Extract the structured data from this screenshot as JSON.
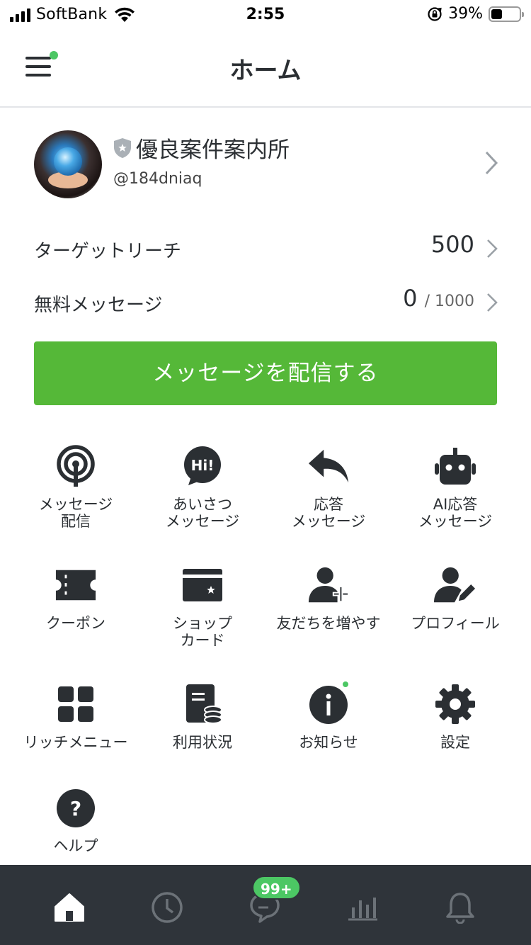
{
  "status_bar": {
    "carrier": "SoftBank",
    "time": "2:55",
    "battery_percent": "39%",
    "battery_level": 0.39
  },
  "header": {
    "title": "ホーム"
  },
  "account": {
    "name": "優良案件案内所",
    "id": "@184dniaq"
  },
  "stats": {
    "target_reach_label": "ターゲットリーチ",
    "target_reach_value": "500",
    "free_messages_label": "無料メッセージ",
    "free_messages_used": "0",
    "free_messages_limit": "/ 1000"
  },
  "broadcast_button": "メッセージを配信する",
  "menu": [
    {
      "label": "メッセージ\n配信",
      "icon": "broadcast-icon"
    },
    {
      "label": "あいさつ\nメッセージ",
      "icon": "hi-bubble-icon"
    },
    {
      "label": "応答\nメッセージ",
      "icon": "reply-icon"
    },
    {
      "label": "AI応答\nメッセージ",
      "icon": "robot-icon"
    },
    {
      "label": "クーポン",
      "icon": "coupon-icon"
    },
    {
      "label": "ショップ\nカード",
      "icon": "shop-card-icon"
    },
    {
      "label": "友だちを増やす",
      "icon": "add-friend-icon"
    },
    {
      "label": "プロフィール",
      "icon": "profile-edit-icon"
    },
    {
      "label": "リッチメニュー",
      "icon": "rich-menu-icon"
    },
    {
      "label": "利用状況",
      "icon": "usage-icon"
    },
    {
      "label": "お知らせ",
      "icon": "info-icon"
    },
    {
      "label": "設定",
      "icon": "gear-icon"
    },
    {
      "label": "ヘルプ",
      "icon": "help-icon"
    }
  ],
  "tabbar": {
    "chat_badge": "99+",
    "tabs": [
      "home-icon",
      "clock-icon",
      "chat-icon",
      "stats-icon",
      "bell-icon"
    ]
  },
  "colors": {
    "accent_green": "#55b838",
    "dot_green": "#4cc764",
    "tabbar_bg": "#2f343a",
    "text": "#2b2f33"
  }
}
